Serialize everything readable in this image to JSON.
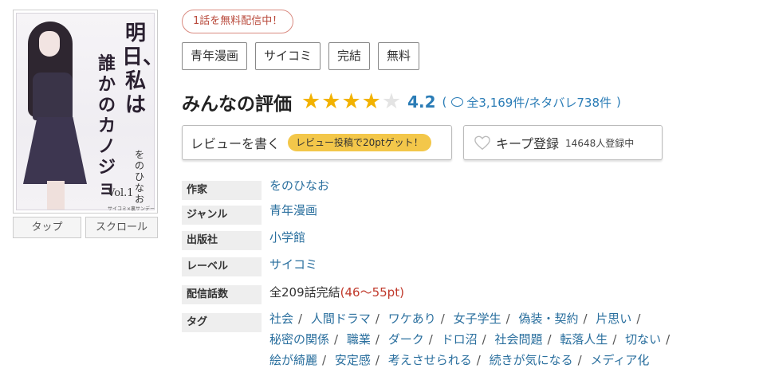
{
  "cover": {
    "title_line1": "明日、",
    "title_line2": "私は",
    "title_line3": "誰かの",
    "title_line4": "カノジョ",
    "author": "をのひなお",
    "volume": "Vol.1",
    "imprint": "サイコミ×裏サンデー"
  },
  "view_buttons": {
    "tap": "タップ",
    "scroll": "スクロール"
  },
  "free_badge": "1話を無料配信中！",
  "genre_tags": [
    "青年漫画",
    "サイコミ",
    "完結",
    "無料"
  ],
  "rating": {
    "heading": "みんなの評価",
    "stars_filled": 4,
    "stars_total": 5,
    "score": "4.2",
    "open_paren": "(",
    "review_summary": "全3,169件/ネタバレ738件",
    "close_paren": ")"
  },
  "review_button": {
    "label": "レビューを書く",
    "promo": "レビュー投稿で20ptゲット！"
  },
  "keep_button": {
    "label": "キープ登録",
    "count": "14648人登録中"
  },
  "info": {
    "author_label": "作家",
    "author_value": "をのひなお",
    "genre_label": "ジャンル",
    "genre_value": "青年漫画",
    "publisher_label": "出版社",
    "publisher_value": "小学館",
    "label_label": "レーベル",
    "label_value": "サイコミ",
    "episodes_label": "配信話数",
    "episodes_value": "全209話完結",
    "episodes_price": "(46〜55pt)",
    "tags_label": "タグ"
  },
  "tags": [
    "社会",
    "人間ドラマ",
    "ワケあり",
    "女子学生",
    "偽装・契約",
    "片思い",
    "秘密の関係",
    "職業",
    "ダーク",
    "ドロ沼",
    "社会問題",
    "転落人生",
    "切ない",
    "絵が綺麗",
    "安定感",
    "考えさせられる",
    "続きが気になる",
    "メディア化"
  ],
  "colors": {
    "link": "#2a6f9e",
    "star": "#f2b200",
    "promo": "#f3c74a",
    "badge": "#b94a3c",
    "price": "#c0392b"
  }
}
